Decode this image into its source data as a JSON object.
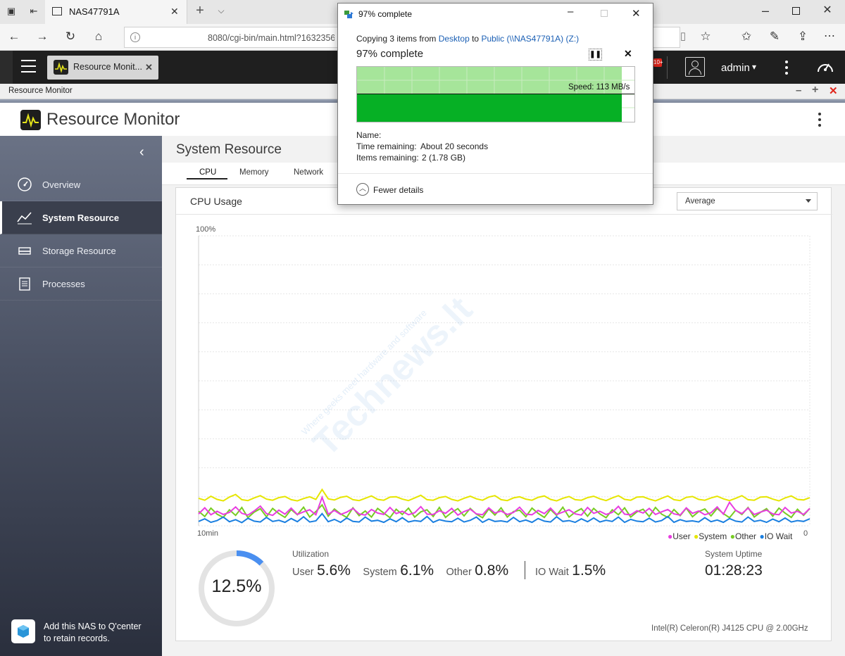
{
  "browser": {
    "tab_title": "NAS47791A",
    "url": "8080/cgi-bin/main.html?1632356"
  },
  "qts": {
    "app_tab_label": "Resource Monit...",
    "user": "admin",
    "user_caret": "▾",
    "notification_badge": "10+"
  },
  "app_strip": {
    "title": "Resource Monitor"
  },
  "app": {
    "title": "Resource Monitor"
  },
  "sidebar": {
    "items": [
      {
        "label": "Overview",
        "icon": "gauge-icon"
      },
      {
        "label": "System Resource",
        "icon": "chart-line-icon",
        "active": true
      },
      {
        "label": "Storage Resource",
        "icon": "storage-icon"
      },
      {
        "label": "Processes",
        "icon": "list-icon"
      }
    ],
    "qcenter": {
      "line1": "Add this NAS to Q'center",
      "line2": "to retain records."
    }
  },
  "main": {
    "section_title": "System Resource",
    "tabs": [
      "CPU",
      "Memory",
      "Network"
    ],
    "active_tab": "CPU",
    "panel_title": "CPU Usage",
    "select_value": "Average"
  },
  "chart_data": {
    "type": "line",
    "ylabel_top": "100%",
    "xlabel_left": "10min",
    "xlabel_right": "0",
    "ylim": [
      0,
      100
    ],
    "n_points": 100,
    "series": [
      {
        "name": "User",
        "color": "#e83de0",
        "values": [
          4.1,
          6.2,
          3.8,
          5.0,
          3.9,
          4.6,
          6.5,
          4.3,
          3.7,
          5.1,
          6.8,
          4.2,
          3.6,
          5.4,
          4.0,
          6.1,
          3.9,
          4.8,
          5.5,
          3.8,
          9.8,
          4.0,
          5.3,
          3.9,
          4.7,
          6.0,
          4.1,
          3.7,
          5.6,
          4.4,
          3.9,
          6.3,
          4.2,
          5.0,
          3.8,
          4.5,
          6.6,
          4.0,
          3.9,
          5.2,
          4.3,
          6.0,
          3.7,
          4.9,
          5.7,
          4.1,
          3.8,
          6.2,
          4.4,
          5.1,
          3.9,
          4.6,
          6.4,
          4.0,
          3.8,
          5.3,
          4.2,
          6.1,
          3.9,
          4.7,
          5.5,
          4.1,
          3.7,
          6.3,
          4.3,
          5.0,
          3.9,
          4.6,
          6.7,
          4.0,
          3.8,
          5.2,
          4.4,
          6.0,
          3.9,
          4.8,
          5.6,
          4.1,
          3.7,
          6.2,
          4.3,
          5.1,
          3.8,
          4.5,
          6.5,
          4.0,
          8.1,
          5.3,
          4.2,
          6.1,
          3.9,
          4.7,
          5.4,
          4.1,
          3.8,
          6.3,
          4.4,
          5.0,
          3.9,
          6.0
        ]
      },
      {
        "name": "System",
        "color": "#e6e600",
        "values": [
          9.5,
          8.8,
          10.2,
          9.1,
          8.6,
          9.9,
          10.8,
          9.0,
          8.7,
          9.6,
          10.4,
          9.2,
          8.8,
          9.7,
          10.1,
          9.0,
          8.6,
          9.4,
          10.0,
          9.1,
          12.5,
          9.3,
          8.9,
          9.8,
          10.2,
          9.0,
          8.7,
          9.5,
          10.3,
          9.1,
          8.8,
          9.9,
          10.0,
          9.2,
          8.7,
          9.6,
          10.5,
          9.0,
          8.8,
          9.7,
          10.1,
          9.1,
          8.6,
          9.5,
          10.2,
          9.3,
          8.8,
          9.9,
          10.4,
          9.0,
          8.7,
          9.6,
          10.0,
          9.2,
          8.8,
          9.8,
          10.3,
          9.1,
          8.6,
          9.5,
          10.1,
          9.0,
          8.8,
          9.7,
          10.2,
          9.3,
          8.7,
          9.6,
          10.4,
          9.1,
          8.8,
          9.9,
          10.0,
          9.2,
          8.6,
          9.5,
          10.3,
          9.0,
          8.7,
          9.8,
          10.1,
          9.1,
          8.8,
          9.6,
          10.2,
          9.3,
          8.7,
          9.5,
          10.4,
          9.0,
          8.8,
          9.9,
          10.0,
          9.2,
          8.6,
          9.6,
          10.3,
          9.1,
          8.9,
          9.7
        ]
      },
      {
        "name": "Other",
        "color": "#77cc22",
        "values": [
          5.0,
          3.2,
          6.1,
          4.0,
          2.9,
          5.5,
          3.6,
          6.3,
          2.8,
          4.7,
          5.9,
          3.1,
          6.0,
          4.2,
          2.9,
          5.6,
          3.8,
          6.4,
          3.0,
          4.9,
          7.2,
          3.3,
          5.8,
          4.1,
          2.9,
          6.2,
          3.5,
          5.1,
          3.0,
          6.0,
          4.4,
          2.8,
          5.7,
          3.9,
          6.1,
          3.0,
          4.8,
          5.5,
          3.2,
          6.3,
          2.9,
          4.6,
          5.9,
          3.4,
          6.0,
          4.0,
          2.8,
          5.8,
          3.7,
          6.2,
          3.0,
          4.9,
          5.4,
          3.1,
          6.1,
          4.3,
          2.9,
          5.6,
          3.6,
          6.4,
          3.0,
          4.7,
          5.9,
          3.3,
          6.0,
          4.1,
          2.8,
          5.5,
          3.8,
          6.2,
          3.0,
          4.8,
          5.7,
          3.2,
          6.3,
          4.0,
          2.9,
          5.6,
          3.5,
          6.1,
          3.1,
          4.9,
          5.8,
          3.4,
          6.0,
          4.2,
          2.8,
          5.4,
          3.9,
          6.3,
          3.0,
          4.6,
          5.9,
          3.3,
          6.1,
          4.4,
          2.9,
          5.7,
          3.6,
          6.0
        ]
      },
      {
        "name": "IO Wait",
        "color": "#1a7fe0",
        "values": [
          1.5,
          2.4,
          1.2,
          1.8,
          3.0,
          1.4,
          2.1,
          1.1,
          2.6,
          1.6,
          1.3,
          2.9,
          1.5,
          1.9,
          1.2,
          2.5,
          1.4,
          3.1,
          1.3,
          1.7,
          4.2,
          1.4,
          2.2,
          1.2,
          2.7,
          1.5,
          1.3,
          3.0,
          1.6,
          1.9,
          1.2,
          2.4,
          1.4,
          2.8,
          1.3,
          1.8,
          1.5,
          3.2,
          1.2,
          2.1,
          1.6,
          1.4,
          2.6,
          1.3,
          1.9,
          3.0,
          1.2,
          2.3,
          1.5,
          1.7,
          1.3,
          2.9,
          1.4,
          2.0,
          1.2,
          2.5,
          1.6,
          1.3,
          3.1,
          1.5,
          1.8,
          1.2,
          2.4,
          1.4,
          2.7,
          1.3,
          1.9,
          1.5,
          3.0,
          1.2,
          2.2,
          1.6,
          1.4,
          2.6,
          1.3,
          1.8,
          3.2,
          1.2,
          2.1,
          1.5,
          1.7,
          1.3,
          2.8,
          1.4,
          2.0,
          1.2,
          2.5,
          1.6,
          1.3,
          3.0,
          1.5,
          1.9,
          1.2,
          2.3,
          1.4,
          2.7,
          1.3,
          1.8,
          1.5,
          2.4
        ]
      }
    ]
  },
  "summary": {
    "gauge_value": "12.5%",
    "gauge_fraction": 0.125,
    "gauge_color": "#4a8ff0",
    "utilization_label": "Utilization",
    "metrics": [
      {
        "label": "User",
        "value": "5.6%"
      },
      {
        "label": "System",
        "value": "6.1%"
      },
      {
        "label": "Other",
        "value": "0.8%"
      },
      {
        "label": "IO Wait",
        "value": "1.5%"
      }
    ],
    "uptime_label": "System Uptime",
    "uptime_value": "01:28:23",
    "cpu_model": "Intel(R) Celeron(R) J4125 CPU @ 2.00GHz"
  },
  "dialog": {
    "title": "97% complete",
    "copying_prefix": "Copying 3 items from",
    "from": "Desktop",
    "to_word": "to",
    "to": "Public (\\\\NAS47791A) (Z:)",
    "big_status": "97% complete",
    "progress_fraction": 0.97,
    "speed": "Speed: 113 MB/s",
    "name_label": "Name:",
    "time_label": "Time remaining:",
    "time_value": "About 20 seconds",
    "items_label": "Items remaining:",
    "items_value": "2 (1.78 GB)",
    "fewer_details": "Fewer details",
    "accent": "#06b025"
  },
  "watermark": {
    "brand": "Technews.lt",
    "tagline": "Where geeks meet hardware and software"
  }
}
